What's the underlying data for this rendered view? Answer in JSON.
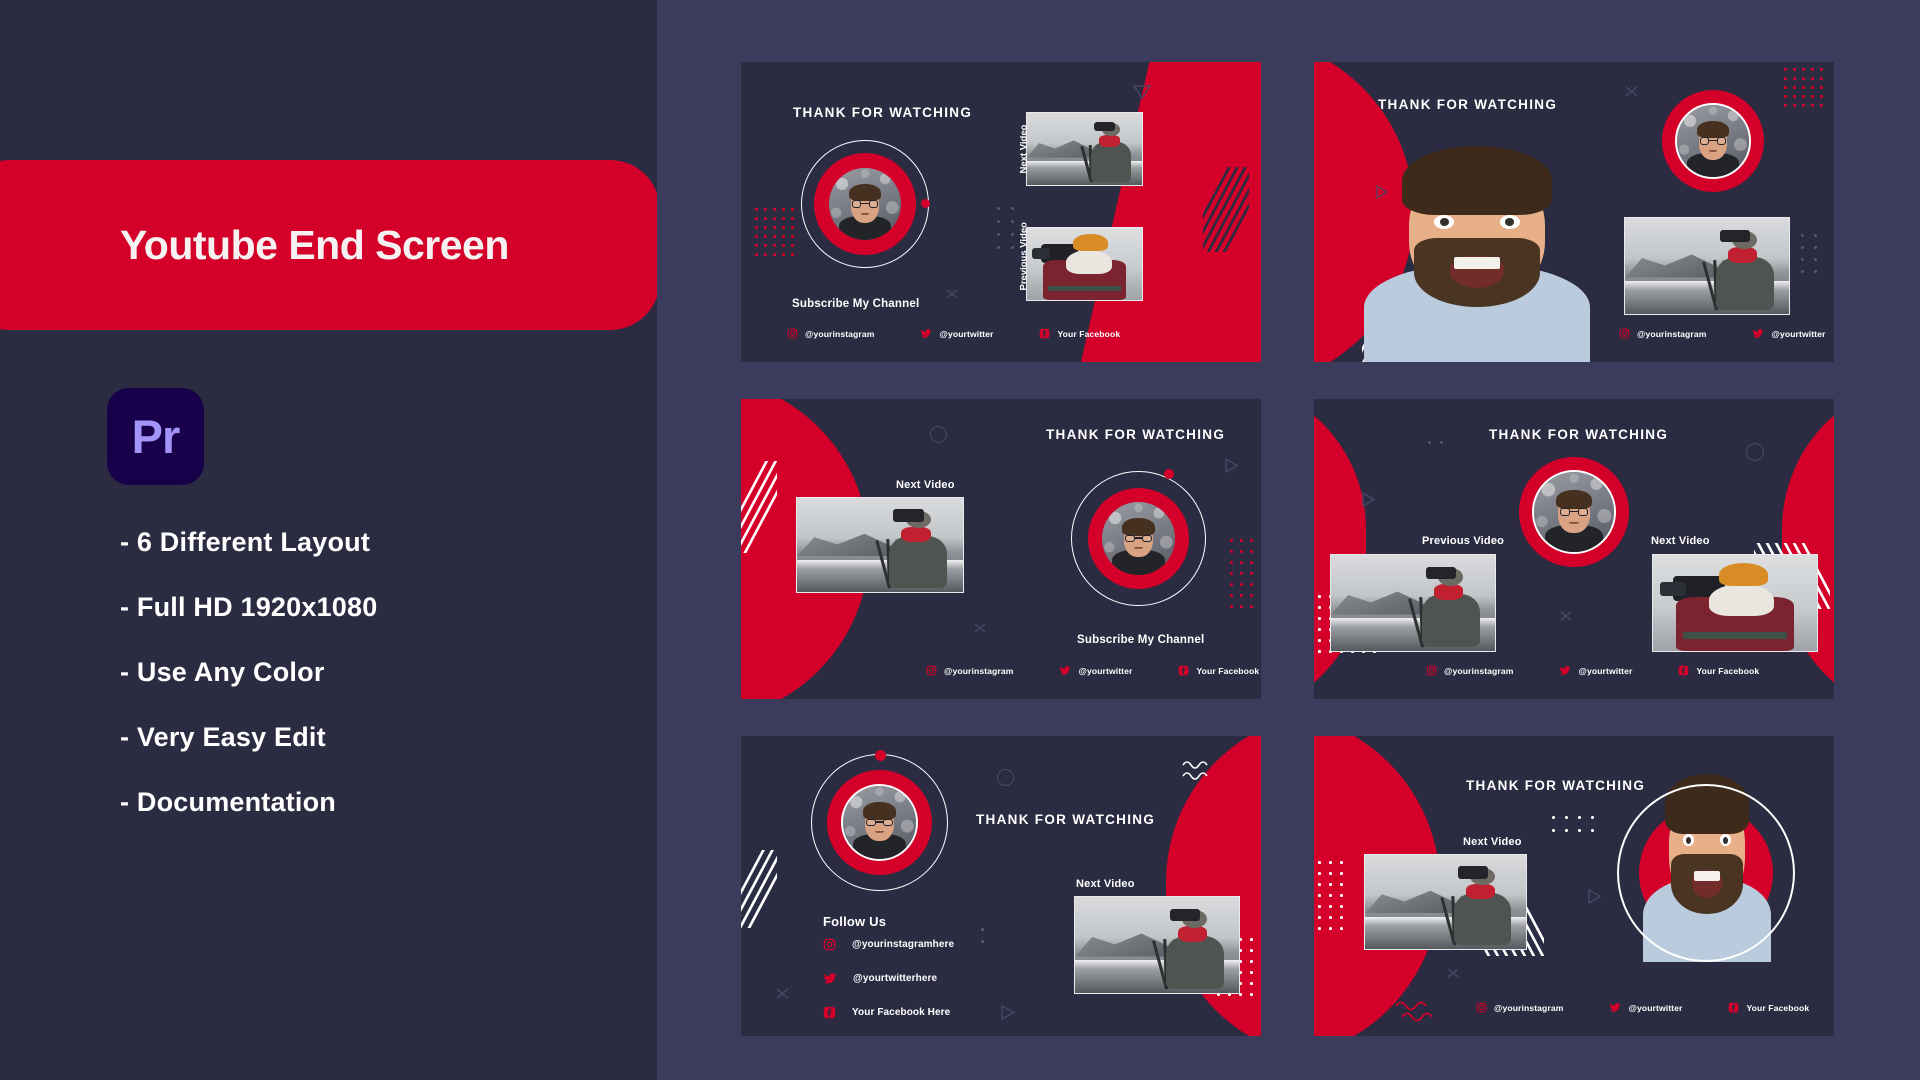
{
  "left": {
    "title": "Youtube End Screen",
    "app_icon_label": "Pr",
    "app_icon_name": "adobe-premiere-pro-icon",
    "features": [
      "- 6 Different  Layout",
      "- Full HD 1920x1080",
      "- Use Any Color",
      "- Very Easy Edit",
      "- Documentation"
    ]
  },
  "colors": {
    "accent_red": "#d40029",
    "panel_dark": "#2b2c42",
    "panel_light": "#3b3b5c",
    "card_bg": "#2b2c42",
    "text_white": "#ffffff",
    "premiere_bg": "#18004a",
    "premiere_fg": "#a294f9"
  },
  "common": {
    "headline": "THANK FOR WATCHING",
    "subscribe": "Subscribe My Channel",
    "follow_us": "Follow Us",
    "next_video": "Next Video",
    "previous_video": "Previous Video",
    "instagram_handle": "@yourinstagram",
    "twitter_handle": "@yourtwitter",
    "facebook_handle": "Your Facebook",
    "instagram_handle_long": "@yourinstagramhere",
    "twitter_handle_long": "@yourtwitterhere",
    "facebook_handle_long": "Your Facebook Here"
  },
  "cards": [
    {
      "id": "card-1",
      "name": "layout-1-center-avatar-two-videos",
      "headline": "THANK FOR WATCHING",
      "subscribe": "Subscribe My Channel",
      "video_labels": [
        "Next Video",
        "Previous Video"
      ],
      "socials": [
        "@yourinstagram",
        "@yourtwitter",
        "Your Facebook"
      ]
    },
    {
      "id": "card-2",
      "name": "layout-2-person-left-avatar-right",
      "headline": "THANK FOR WATCHING",
      "video_labels": [],
      "socials": [
        "@yourinstagram",
        "@yourtwitter"
      ]
    },
    {
      "id": "card-3",
      "name": "layout-3-video-left-avatar-right",
      "headline": "THANK FOR WATCHING",
      "subscribe": "Subscribe My Channel",
      "video_labels": [
        "Next Video"
      ],
      "socials": [
        "@yourinstagram",
        "@yourtwitter",
        "Your Facebook"
      ]
    },
    {
      "id": "card-4",
      "name": "layout-4-center-avatar-side-videos",
      "headline": "THANK FOR WATCHING",
      "video_labels": [
        "Previous Video",
        "Next Video"
      ],
      "socials": [
        "@yourinstagram",
        "@yourtwitter",
        "Your Facebook"
      ]
    },
    {
      "id": "card-5",
      "name": "layout-5-avatar-left-follow-list",
      "headline": "THANK FOR WATCHING",
      "follow_us": "Follow Us",
      "video_labels": [
        "Next Video"
      ],
      "socials": [
        "@yourinstagramhere",
        "@yourtwitterhere",
        "Your Facebook Here"
      ]
    },
    {
      "id": "card-6",
      "name": "layout-6-video-left-person-circle-right",
      "headline": "THANK FOR WATCHING",
      "video_labels": [
        "Next Video"
      ],
      "socials": [
        "@yourinstagram",
        "@yourtwitter",
        "Your Facebook"
      ]
    }
  ]
}
